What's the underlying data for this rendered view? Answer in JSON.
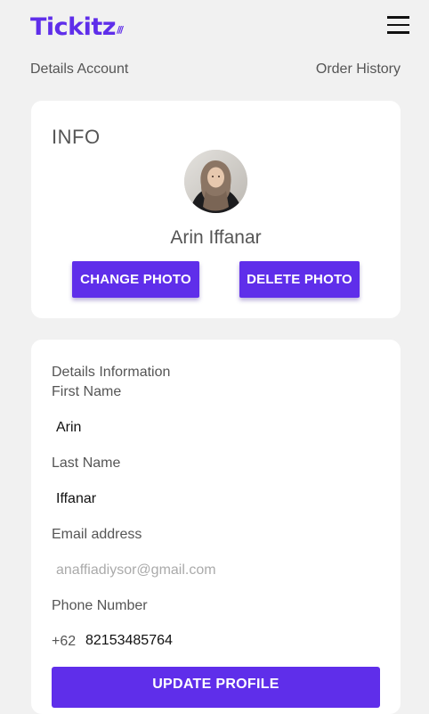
{
  "header": {
    "logo": "Tickitz",
    "logo_mark": "///"
  },
  "tabs": {
    "details_account": "Details Account",
    "order_history": "Order History"
  },
  "info_card": {
    "title": "INFO",
    "name": "Arin Iffanar",
    "change_photo": "CHANGE PHOTO",
    "delete_photo": "DELETE PHOTO"
  },
  "details": {
    "title": "Details Information",
    "first_name_label": "First Name",
    "first_name": "Arin",
    "last_name_label": "Last Name",
    "last_name": "Iffanar",
    "email_label": "Email address",
    "email_placeholder": "anaffiadiysor@gmail.com",
    "phone_label": "Phone Number",
    "phone_prefix": "+62",
    "phone": "82153485764",
    "update_button": "UPDATE PROFILE"
  },
  "colors": {
    "brand": "#5f2eea",
    "background": "#f1f1f1",
    "card": "#ffffff"
  }
}
